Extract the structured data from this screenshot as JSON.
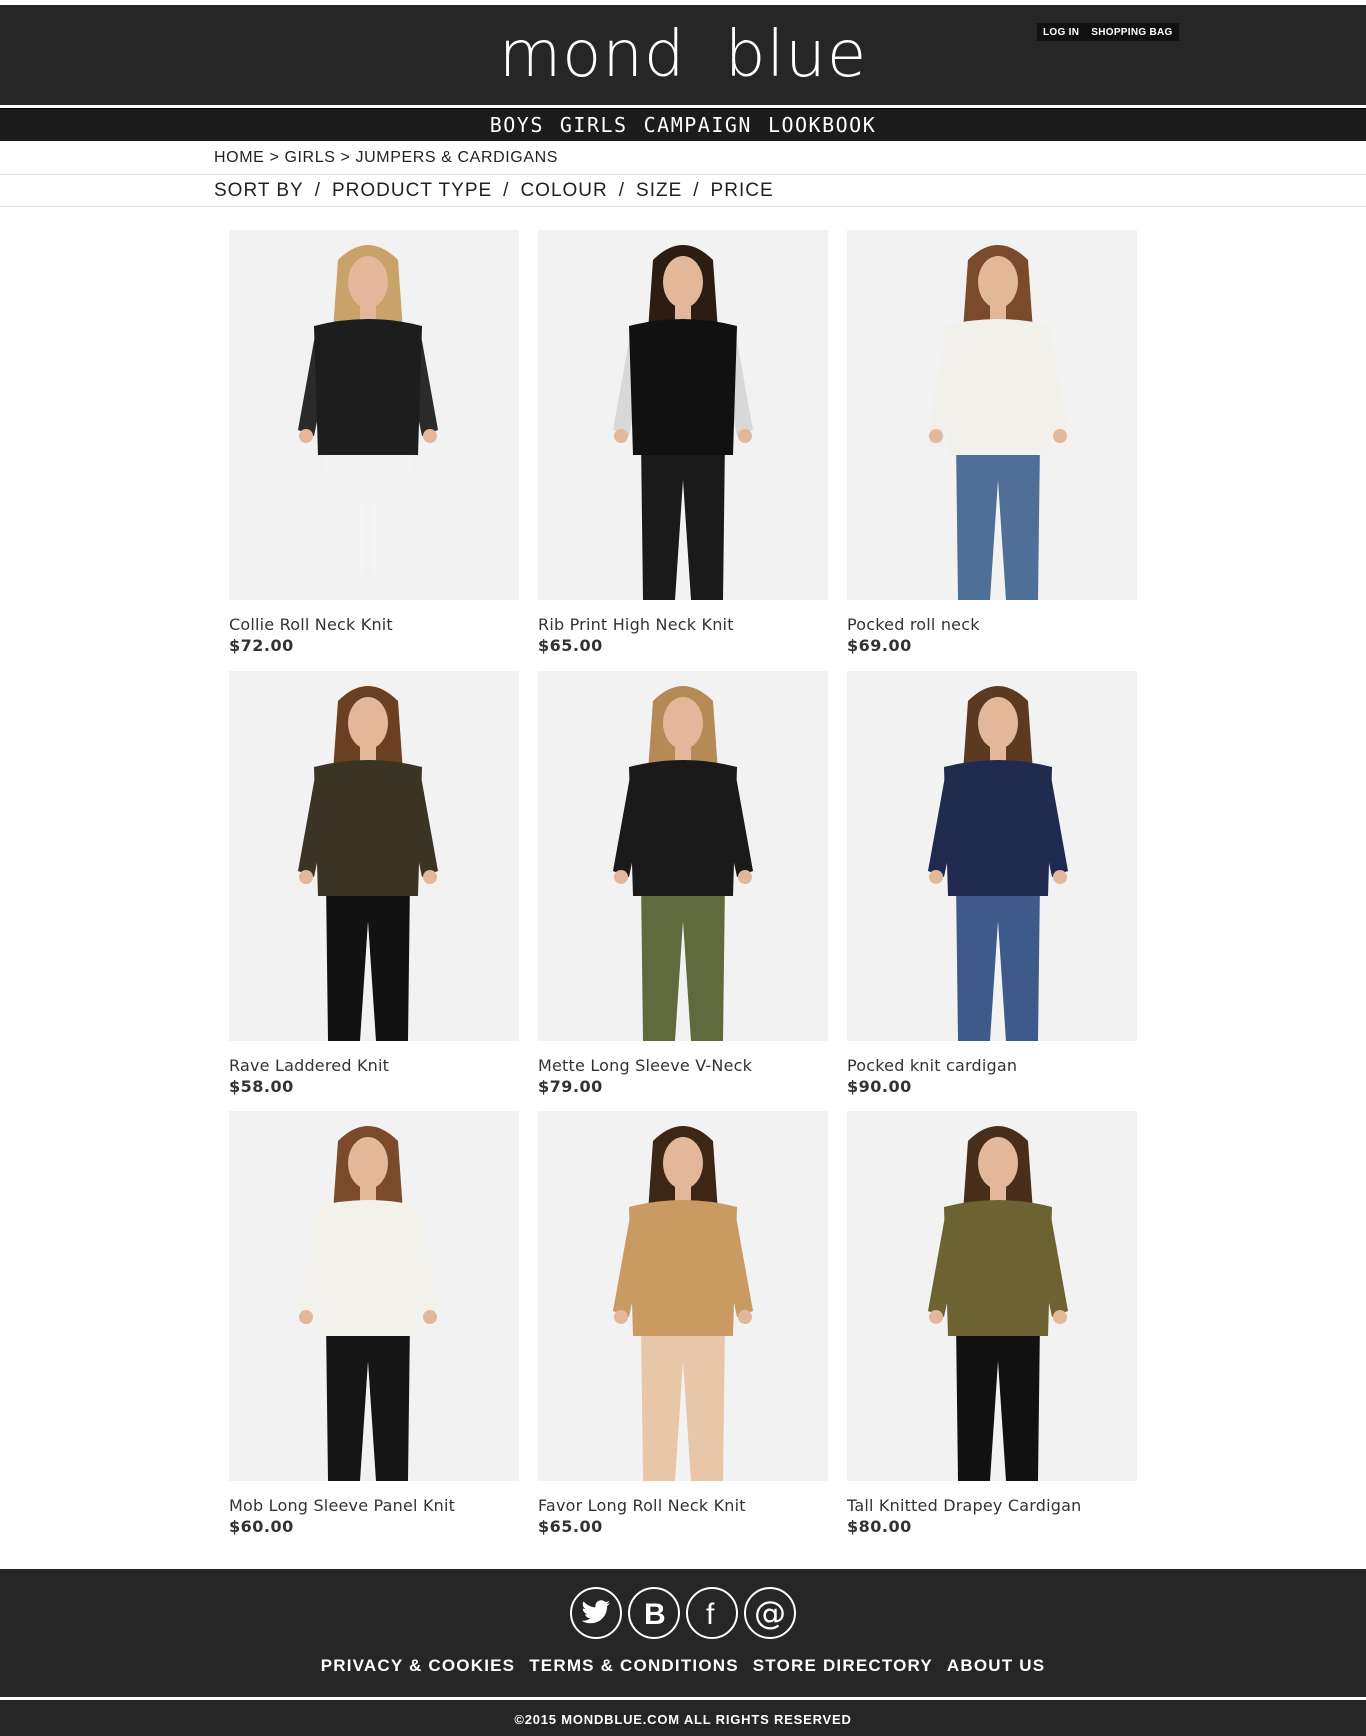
{
  "header": {
    "logo": "mond blue",
    "account_links": [
      "LOG IN",
      "SHOPPING BAG"
    ],
    "nav": [
      "BOYS",
      "GIRLS",
      "CAMPAIGN",
      "LOOKBOOK"
    ]
  },
  "breadcrumb": {
    "items": [
      "HOME",
      "GIRLS",
      "JUMPERS & CARDIGANS"
    ],
    "separator": ">"
  },
  "filters": {
    "items": [
      "SORT BY",
      "PRODUCT TYPE",
      "COLOUR",
      "SIZE",
      "PRICE"
    ],
    "separator": "/"
  },
  "products": [
    {
      "name": "Collie Roll Neck Knit",
      "price": "$72.00",
      "colors": {
        "top": "#1d1d1d",
        "bottom": "#f4f4f4",
        "hair": "#c9a26a",
        "sleeve": "#2a2a2a"
      }
    },
    {
      "name": "Rib Print High Neck Knit",
      "price": "$65.00",
      "colors": {
        "top": "#111111",
        "bottom": "#1a1a1a",
        "hair": "#2b1d14",
        "sleeve": "#d8d8d8"
      }
    },
    {
      "name": "Pocked roll neck",
      "price": "$69.00",
      "colors": {
        "top": "#f2f0ea",
        "bottom": "#4f6e98",
        "hair": "#7a4a2a",
        "sleeve": "#f2f0ea"
      }
    },
    {
      "name": "Rave Laddered Knit",
      "price": "$58.00",
      "colors": {
        "top": "#3b3424",
        "bottom": "#121212",
        "hair": "#6b3f22",
        "sleeve": "#3b3424"
      }
    },
    {
      "name": "Mette Long Sleeve V-Neck",
      "price": "$79.00",
      "colors": {
        "top": "#1a1a1a",
        "bottom": "#5f6a3d",
        "hair": "#b58a57",
        "sleeve": "#1a1a1a"
      }
    },
    {
      "name": "Pocked knit cardigan",
      "price": "$90.00",
      "colors": {
        "top": "#1f2a4e",
        "bottom": "#3d5a8a",
        "hair": "#5c3a22",
        "sleeve": "#1f2a4e"
      }
    },
    {
      "name": "Mob Long Sleeve Panel Knit",
      "price": "$60.00",
      "colors": {
        "top": "#f3f1ec",
        "bottom": "#151515",
        "hair": "#7b4a2b",
        "sleeve": "#f3f1ec"
      }
    },
    {
      "name": "Favor Long Roll Neck Knit",
      "price": "$65.00",
      "colors": {
        "top": "#c99a62",
        "bottom": "#e8c7a8",
        "hair": "#3e2616",
        "sleeve": "#c99a62"
      }
    },
    {
      "name": "Tall Knitted Drapey Cardigan",
      "price": "$80.00",
      "colors": {
        "top": "#6c6232",
        "bottom": "#111111",
        "hair": "#4a2e1c",
        "sleeve": "#6c6232"
      }
    }
  ],
  "footer": {
    "social_icons": [
      "twitter-icon",
      "blogger-icon",
      "facebook-icon",
      "email-icon"
    ],
    "links": [
      "PRIVACY & COOKIES",
      "TERMS & CONDITIONS",
      "STORE DIRECTORY",
      "ABOUT US"
    ],
    "copyright": "©2015 MONDBLUE.COM  ALL RIGHTS RESERVED"
  },
  "colors": {
    "header_bg": "#262626",
    "image_bg": "#f2f2f2"
  }
}
